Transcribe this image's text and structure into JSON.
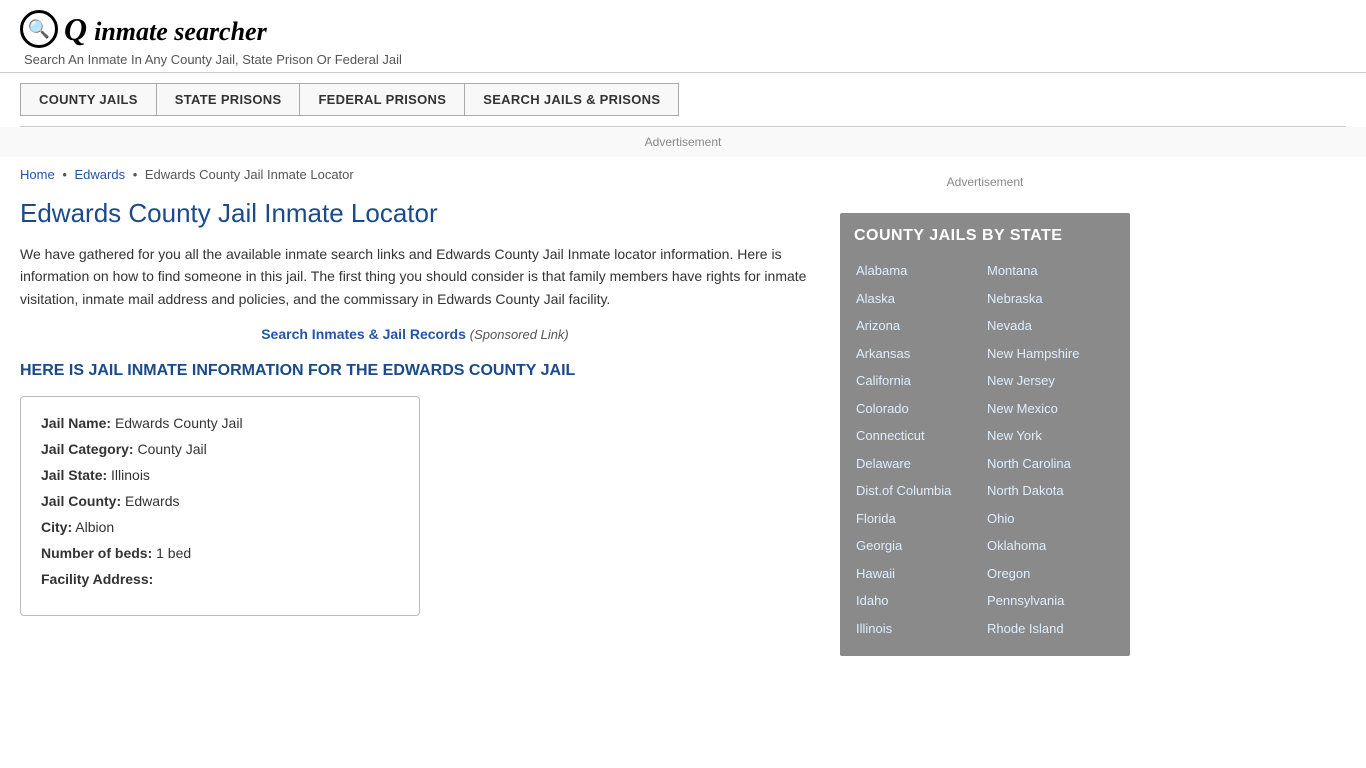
{
  "header": {
    "logo_icon": "🔍",
    "logo_text": "inmate searcher",
    "tagline": "Search An Inmate In Any County Jail, State Prison Or Federal Jail"
  },
  "nav": {
    "items": [
      {
        "id": "county-jails",
        "label": "COUNTY JAILS"
      },
      {
        "id": "state-prisons",
        "label": "STATE PRISONS"
      },
      {
        "id": "federal-prisons",
        "label": "FEDERAL PRISONS"
      },
      {
        "id": "search-jails",
        "label": "SEARCH JAILS & PRISONS"
      }
    ]
  },
  "ad_label": "Advertisement",
  "breadcrumb": {
    "home": "Home",
    "sep1": "•",
    "edwards": "Edwards",
    "sep2": "•",
    "current": "Edwards County Jail Inmate Locator"
  },
  "page_title": "Edwards County Jail Inmate Locator",
  "description": "We have gathered for you all the available inmate search links and Edwards County Jail Inmate locator information. Here is information on how to find someone in this jail. The first thing you should consider is that family members have rights for inmate visitation, inmate mail address and policies, and the commissary in Edwards County Jail facility.",
  "sponsored": {
    "link_text": "Search Inmates & Jail Records",
    "label": "(Sponsored Link)"
  },
  "jail_info_heading": "HERE IS JAIL INMATE INFORMATION FOR THE EDWARDS COUNTY JAIL",
  "jail_details": {
    "name_label": "Jail Name:",
    "name_value": "Edwards County Jail",
    "category_label": "Jail Category:",
    "category_value": "County Jail",
    "state_label": "Jail State:",
    "state_value": "Illinois",
    "county_label": "Jail County:",
    "county_value": "Edwards",
    "city_label": "City:",
    "city_value": "Albion",
    "beds_label": "Number of beds:",
    "beds_value": "1 bed",
    "address_label": "Facility Address:"
  },
  "sidebar": {
    "ad_label": "Advertisement",
    "state_box_title": "COUNTY JAILS BY STATE",
    "states_col1": [
      "Alabama",
      "Alaska",
      "Arizona",
      "Arkansas",
      "California",
      "Colorado",
      "Connecticut",
      "Delaware",
      "Dist.of Columbia",
      "Florida",
      "Georgia",
      "Hawaii",
      "Idaho",
      "Illinois"
    ],
    "states_col2": [
      "Montana",
      "Nebraska",
      "Nevada",
      "New Hampshire",
      "New Jersey",
      "New Mexico",
      "New York",
      "North Carolina",
      "North Dakota",
      "Ohio",
      "Oklahoma",
      "Oregon",
      "Pennsylvania",
      "Rhode Island"
    ]
  }
}
